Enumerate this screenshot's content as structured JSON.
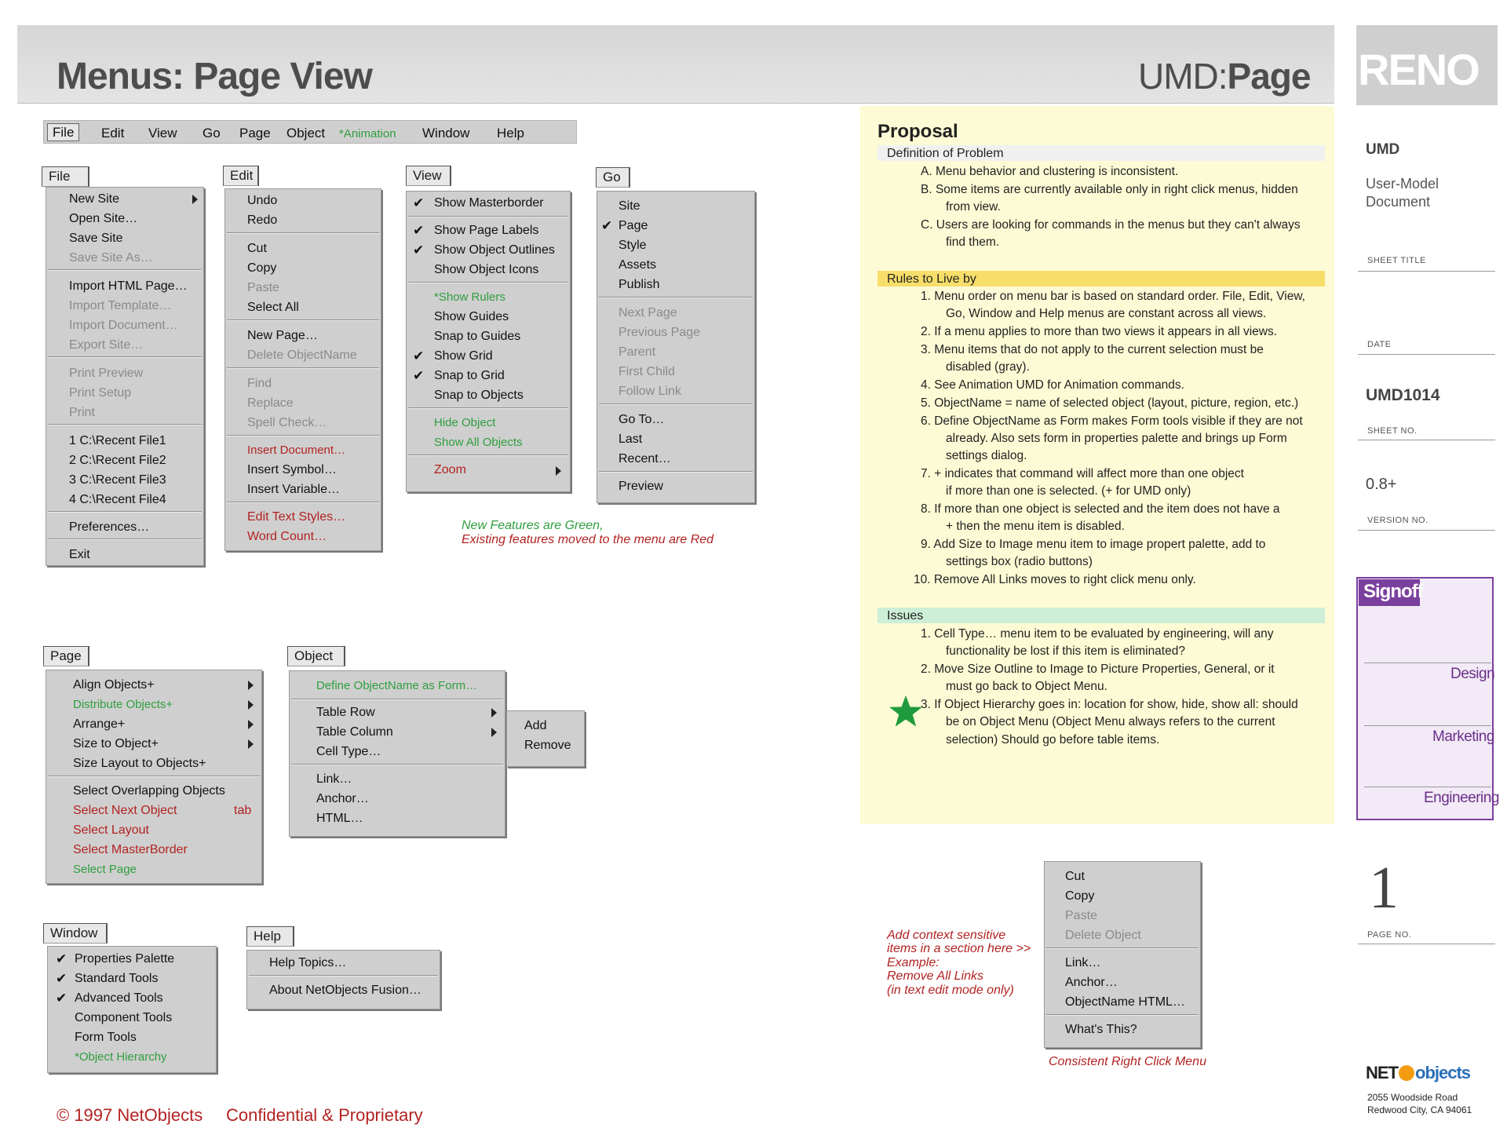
{
  "header": {
    "title": "Menus: Page View",
    "umd_prefix": "UMD:",
    "umd_name": "Page",
    "logo": "RENO"
  },
  "menubar": [
    "File",
    "Edit",
    "View",
    "Go",
    "Page",
    "Object",
    "*Animation",
    "Window",
    "Help"
  ],
  "file_menu": {
    "title": "File",
    "items": [
      "New Site",
      "Open Site…",
      "Save Site",
      "Save Site As…",
      "Import HTML Page…",
      "Import Template…",
      "Import Document…",
      "Export Site…",
      "Print Preview",
      "Print Setup",
      "Print",
      "1 C:\\Recent File1",
      "2 C:\\Recent File2",
      "3 C:\\Recent File3",
      "4 C:\\Recent File4",
      "Preferences…",
      "Exit"
    ]
  },
  "edit_menu": {
    "title": "Edit",
    "items": [
      "Undo",
      "Redo",
      "Cut",
      "Copy",
      "Paste",
      "Select All",
      "New Page…",
      "Delete ObjectName",
      "Find",
      "Replace",
      "Spell Check…",
      "Insert Document…",
      "Insert Symbol…",
      "Insert Variable…",
      "Edit Text Styles…",
      "Word Count…"
    ]
  },
  "view_menu": {
    "title": "View",
    "items": [
      "Show Masterborder",
      "Show Page Labels",
      "Show Object Outlines",
      "Show Object Icons",
      "*Show Rulers",
      "Show Guides",
      "Snap to Guides",
      "Show Grid",
      "Snap to Grid",
      "Snap to Objects",
      "Hide Object",
      "Show All Objects",
      "Zoom"
    ]
  },
  "go_menu": {
    "title": "Go",
    "items": [
      "Site",
      "Page",
      "Style",
      "Assets",
      "Publish",
      "Next Page",
      "Previous Page",
      "Parent",
      "First Child",
      "Follow Link",
      "Go To…",
      "Last",
      "Recent…",
      "Preview"
    ]
  },
  "legend": {
    "green": "New Features are Green,",
    "red": "Existing features moved to the menu are Red"
  },
  "page_menu": {
    "title": "Page",
    "items": [
      "Align Objects+",
      "Distribute Objects+",
      "Arrange+",
      "Size to Object+",
      "Size Layout to Objects+",
      "Select Overlapping Objects",
      "Select Next Object",
      "tab",
      "Select Layout",
      "Select MasterBorder",
      "Select Page"
    ]
  },
  "object_menu": {
    "title": "Object",
    "items": [
      "Define ObjectName as Form…",
      "Table Row",
      "Table Column",
      "Cell Type…",
      "Link…",
      "Anchor…",
      "HTML…"
    ],
    "submenu": [
      "Add",
      "Remove"
    ]
  },
  "window_menu": {
    "title": "Window",
    "items": [
      "Properties Palette",
      "Standard Tools",
      "Advanced Tools",
      "Component Tools",
      "Form Tools",
      "*Object Hierarchy"
    ]
  },
  "help_menu": {
    "title": "Help",
    "items": [
      "Help Topics…",
      "About NetObjects Fusion…"
    ]
  },
  "footer": {
    "copyright": "© 1997 NetObjects",
    "confidential": "Confidential & Proprietary"
  },
  "proposal": {
    "title": "Proposal",
    "definition_head": "Definition of Problem",
    "definition": [
      "A. Menu behavior and clustering is inconsistent.",
      "B.  Some items are currently available only in right click menus, hidden",
      "from view.",
      "C. Users are looking for commands in the menus but they can't always",
      "find them."
    ],
    "rules_head": "Rules to Live by",
    "rules": [
      "1. Menu order on menu bar is based on standard order. File, Edit, View,",
      "Go, Window and Help menus are constant across all views.",
      "2. If a menu applies to more than two views it appears in all views.",
      "3. Menu items that do not apply to the current selection must be",
      "disabled (gray).",
      "4. See Animation UMD for Animation commands.",
      "5. ObjectName = name of selected object (layout, picture, region, etc.)",
      "6. Define ObjectName as Form makes Form tools visible if they are not",
      "already. Also sets form in properties palette and brings up Form",
      "settings dialog.",
      "7. + indicates that command will affect more than one object",
      "if more than one is selected. (+ for UMD only)",
      "8. If more than one object is selected and the item does not have a",
      "+ then the menu item is disabled.",
      "9. Add Size to Image menu item to image propert palette, add to",
      "settings box (radio buttons)",
      "10. Remove All Links moves to right click menu only."
    ],
    "issues_head": "Issues",
    "issues": [
      "1. Cell Type… menu item to be evaluated by engineering, will any",
      "functionality be lost if this item is eliminated?",
      "2. Move Size Outline to Image to Picture Properties, General, or it",
      "must go back to Object Menu.",
      "3. If Object Hierarchy goes in: location for show, hide, show all: should",
      "be on Object Menu (Object Menu always refers to the current",
      "selection) Should go before table items."
    ]
  },
  "context_note": [
    "Add context sensitive",
    "items in a section here >>",
    "Example:",
    "Remove All Links",
    "(in text edit mode only)"
  ],
  "context_menu": {
    "items": [
      "Cut",
      "Copy",
      "Paste",
      "Delete Object",
      "Link…",
      "Anchor…",
      "ObjectName HTML…",
      "What's This?"
    ],
    "caption": "Consistent Right Click Menu"
  },
  "sidebar": {
    "umd": "UMD",
    "doc_line1": "User-Model",
    "doc_line2": "Document",
    "sheet_title_label": "SHEET TITLE",
    "date_label": "DATE",
    "sheet_no": "UMD1014",
    "sheet_no_label": "SHEET NO.",
    "version": "0.8+",
    "version_label": "VERSION NO.",
    "signoff": "Signoff",
    "signoff_items": [
      "Design",
      "Marketing",
      "Engineering"
    ],
    "page_no": "1",
    "page_no_label": "PAGE NO.",
    "company_net": "NET",
    "company_objects": "objects",
    "address1": "2055 Woodside Road",
    "address2": "Redwood City, CA 94061"
  },
  "colors": {
    "new_feature": "#2e9e3e",
    "moved_feature": "#b22222",
    "signoff": "#7b3f9e",
    "proposal_bg": "#fdfbd5",
    "rules_highlight": "#f7de6a",
    "issues_highlight": "#cdeed7"
  }
}
